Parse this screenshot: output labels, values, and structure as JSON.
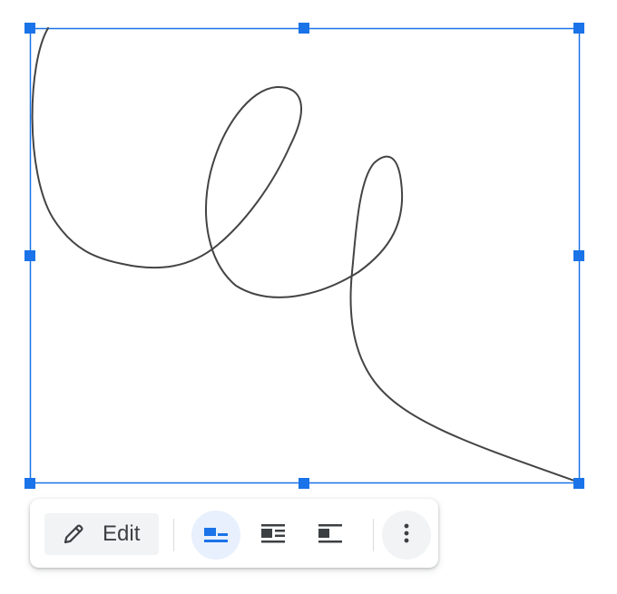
{
  "selection": {
    "accent_color": "#1a73e8",
    "stroke_color": "#444444"
  },
  "toolbar": {
    "edit_label": "Edit",
    "edit_icon": "pencil-icon",
    "wrap_options": [
      {
        "name": "inline-icon",
        "selected": true
      },
      {
        "name": "wrap-text-icon",
        "selected": false
      },
      {
        "name": "break-text-icon",
        "selected": false
      }
    ],
    "more_icon": "more-vertical-icon",
    "active_bg": "#e8f0fe",
    "button_bg": "#f1f3f4"
  }
}
